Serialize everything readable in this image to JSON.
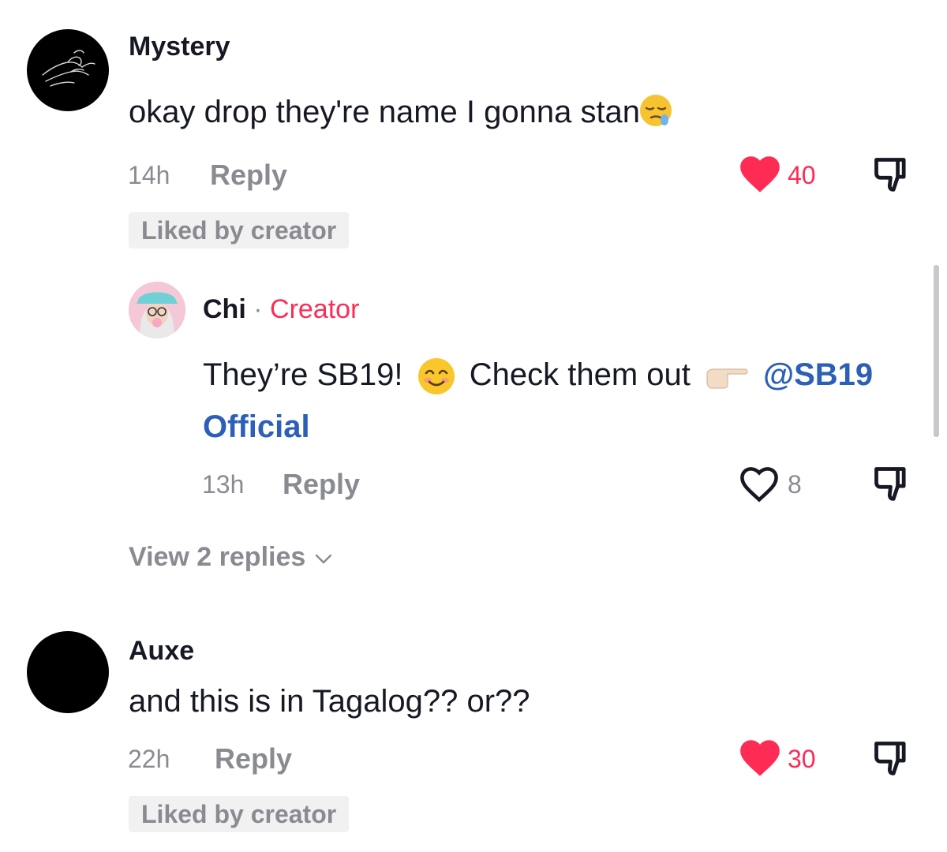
{
  "comments": [
    {
      "username": "Mystery",
      "text": "okay drop they're name I gonna stan",
      "text_emoji": "sleepy-face-emoji",
      "time": "14h",
      "reply_label": "Reply",
      "likes": "40",
      "liked": true,
      "liked_badge": "Liked by creator"
    },
    {
      "username": "Auxe",
      "text": "and this is in Tagalog?? or??",
      "time": "22h",
      "reply_label": "Reply",
      "likes": "30",
      "liked": true,
      "liked_badge": "Liked by creator"
    }
  ],
  "reply": {
    "username": "Chi",
    "separator": "·",
    "creator_label": "Creator",
    "text_part1": "They’re SB19!",
    "text_part2": "Check them out",
    "mention_part1": "@SB19",
    "mention_part2": "Official",
    "time": "13h",
    "reply_label": "Reply",
    "likes": "8",
    "liked": false
  },
  "view_replies": "View 2 replies",
  "colors": {
    "like_red": "#fe2c55",
    "muted": "#8a8b91",
    "mention_blue": "#2b5fb8",
    "badge_bg": "#f1f1f2"
  },
  "icons": {
    "like": "heart-icon",
    "dislike": "dislike-icon",
    "expand": "chevron-down-icon"
  }
}
